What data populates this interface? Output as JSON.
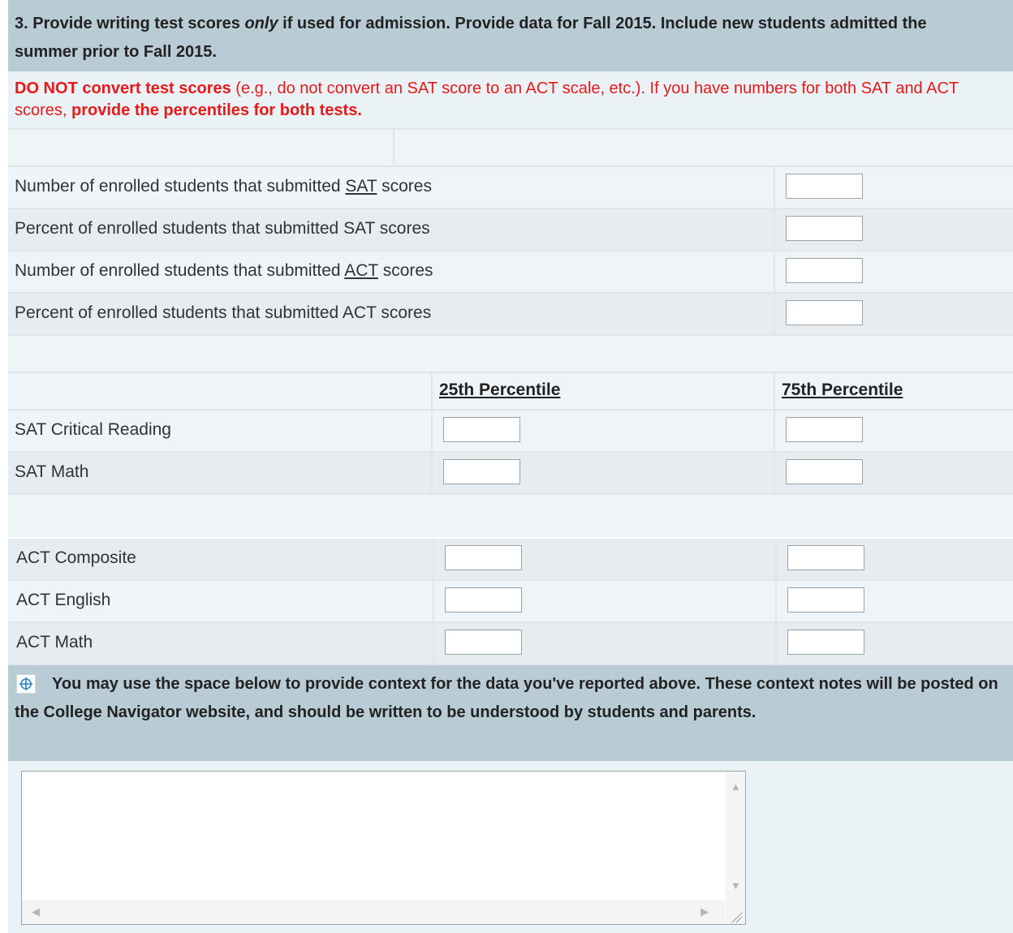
{
  "question": {
    "number": "3.",
    "text_before": "Provide writing test scores ",
    "text_italic": "only",
    "text_after": " if used for admission. Provide data for Fall 2015. Include new students admitted the summer prior to Fall 2015."
  },
  "notice": {
    "bold1": "DO NOT convert test scores",
    "normal1": " (e.g., do not convert an SAT score to an ACT scale, etc.). If you have numbers for both SAT and ACT scores, ",
    "bold2": "provide the percentiles for both tests."
  },
  "submission_rows": [
    {
      "pre": "Number of enrolled students that submitted ",
      "test": "SAT",
      "post": " scores",
      "value": ""
    },
    {
      "pre": "Percent of enrolled students that submitted SAT scores",
      "test": "",
      "post": "",
      "value": ""
    },
    {
      "pre": "Number of enrolled students that submitted ",
      "test": "ACT",
      "post": " scores",
      "value": ""
    },
    {
      "pre": "Percent of enrolled students that submitted ACT scores",
      "test": "",
      "post": "",
      "value": ""
    }
  ],
  "percentile_headers": {
    "p25": "25th Percentile",
    "p75": "75th Percentile"
  },
  "sat_rows": [
    {
      "label": "SAT Critical Reading",
      "p25": "",
      "p75": ""
    },
    {
      "label": "SAT Math",
      "p25": "",
      "p75": ""
    }
  ],
  "act_rows": [
    {
      "label": "ACT Composite",
      "p25": "",
      "p75": ""
    },
    {
      "label": "ACT English",
      "p25": "",
      "p75": ""
    },
    {
      "label": "ACT Math",
      "p25": "",
      "p75": ""
    }
  ],
  "context": {
    "icon": "crosshair-help-icon",
    "text": "You may use the space below to provide context for the data you've reported above. These context notes will be posted on the College Navigator website, and should be written to be understood by students and parents.",
    "value": ""
  },
  "colors": {
    "header_bg": "#b9ccd6",
    "notice_red": "#e81919",
    "row_bg": "#eef4f8"
  }
}
